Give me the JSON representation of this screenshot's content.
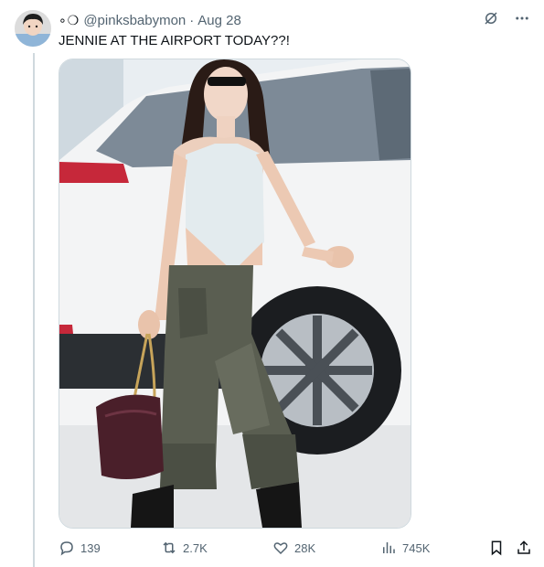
{
  "tweet": {
    "handle_prefix": "∘❍",
    "handle": "@pinksbabymon",
    "separator": "·",
    "date": "Aug 28",
    "text": "JENNIE AT THE AIRPORT TODAY??!"
  },
  "actions": {
    "replies": "139",
    "reposts": "2.7K",
    "likes": "28K",
    "views": "745K"
  },
  "icons": {
    "top": [
      "grok-icon",
      "more-icon"
    ],
    "actions": [
      "reply-icon",
      "repost-icon",
      "like-icon",
      "views-icon",
      "bookmark-icon",
      "share-icon"
    ]
  },
  "colors": {
    "secondary_text": "#536471",
    "primary_text": "#0f1419",
    "divider": "#cfd9de"
  }
}
